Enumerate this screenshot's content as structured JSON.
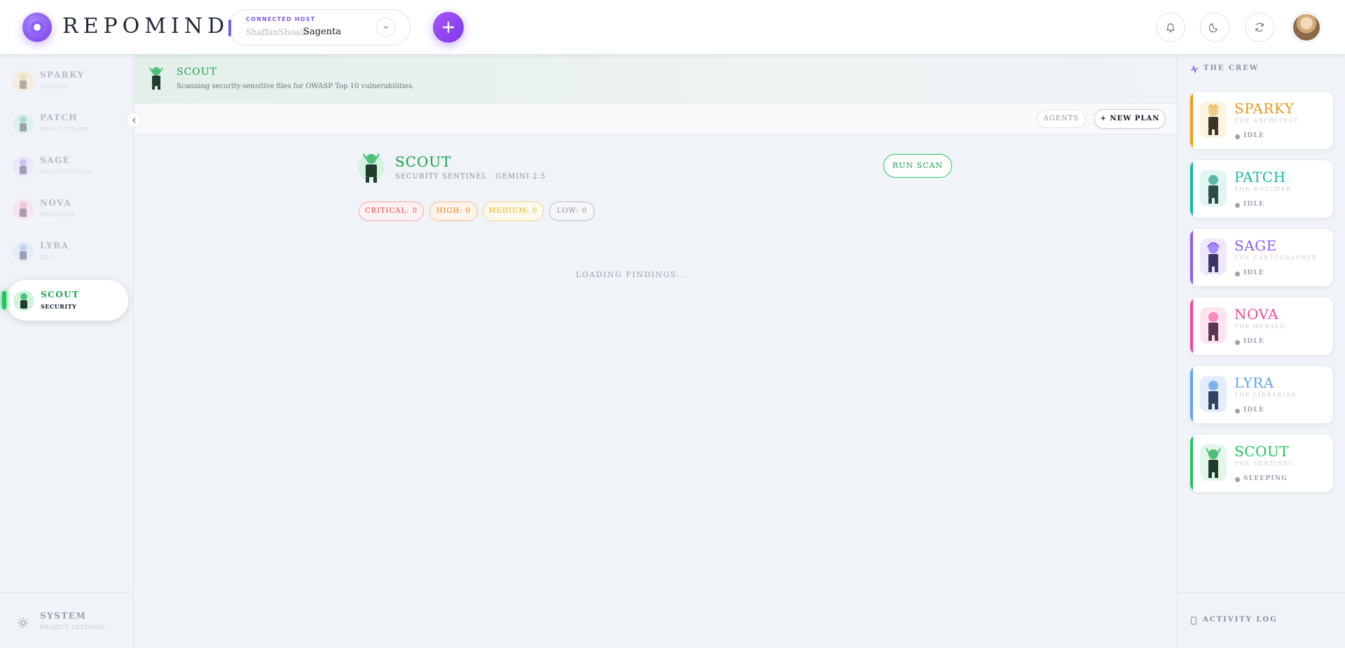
{
  "header": {
    "brand": "REPOMIND",
    "host_label": "CONNECTED HOST",
    "host_user": "ShaffanShoaib",
    "host_repo": "Sagenta",
    "icons": [
      "bell-icon",
      "moon-icon",
      "refresh-icon"
    ]
  },
  "sidebar": {
    "items": [
      {
        "name": "SPARKY",
        "sub": "KANBAN",
        "color": "#e59a1a"
      },
      {
        "name": "PATCH",
        "sub": "SUGGESTIONS",
        "color": "#14b8a6"
      },
      {
        "name": "SAGE",
        "sub": "ARCHITECTURE",
        "color": "#8b5cf6"
      },
      {
        "name": "NOVA",
        "sub": "RELEASES",
        "color": "#ec4899"
      },
      {
        "name": "LYRA",
        "sub": "Q&A",
        "color": "#60a5fa"
      },
      {
        "name": "SCOUT",
        "sub": "SECURITY",
        "color": "#22c55e"
      }
    ],
    "system": {
      "name": "SYSTEM",
      "sub": "PROJECT SETTINGS"
    }
  },
  "banner": {
    "title": "SCOUT",
    "description": "Scanning security-sensitive files for OWASP Top 10 vulnerabilities."
  },
  "toolbar": {
    "agents_label": "AGENTS",
    "new_plan_label": "+ NEW PLAN"
  },
  "scout": {
    "name": "SCOUT",
    "role": "SECURITY SENTINEL · GEMINI 2.5",
    "run_scan_label": "RUN SCAN",
    "severity": {
      "critical": "CRITICAL: 0",
      "high": "HIGH: 0",
      "medium": "MEDIUM: 0",
      "low": "LOW: 0"
    },
    "loading": "LOADING FINDINGS..."
  },
  "crew": {
    "header": "THE CREW",
    "cards": [
      {
        "name": "SPARKY",
        "role": "THE ARCHITECT",
        "status": "IDLE",
        "color": "#e59a1a"
      },
      {
        "name": "PATCH",
        "role": "THE WATCHER",
        "status": "IDLE",
        "color": "#14b8a6"
      },
      {
        "name": "SAGE",
        "role": "THE CARTOGRAPHER",
        "status": "IDLE",
        "color": "#8b5cf6"
      },
      {
        "name": "NOVA",
        "role": "THE HERALD",
        "status": "IDLE",
        "color": "#ec4899"
      },
      {
        "name": "LYRA",
        "role": "THE LIBRARIAN",
        "status": "IDLE",
        "color": "#60a5fa"
      },
      {
        "name": "SCOUT",
        "role": "THE SENTINEL",
        "status": "SLEEPING",
        "color": "#22c55e"
      }
    ],
    "activity_log": "ACTIVITY LOG"
  }
}
